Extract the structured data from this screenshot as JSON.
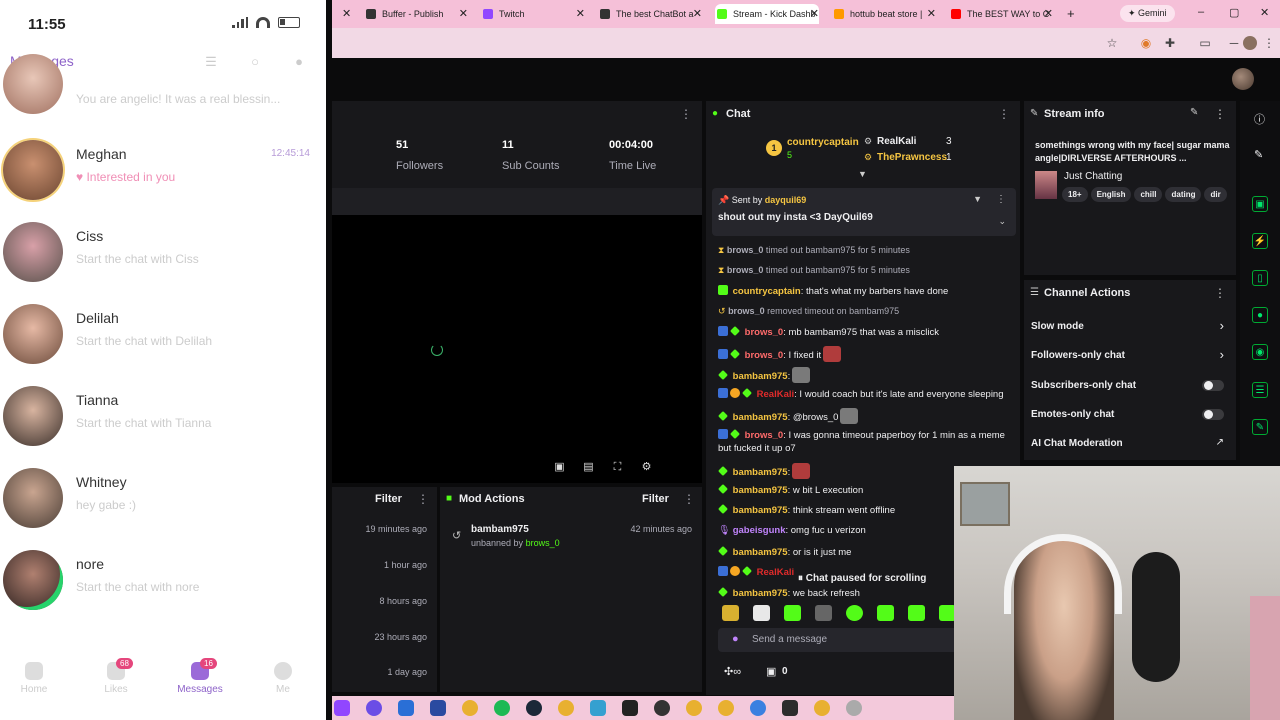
{
  "phone": {
    "time": "11:55",
    "title": "Messages",
    "contacts": [
      {
        "name": "",
        "sub": "You are angelic! It was a real blessin..."
      },
      {
        "name": "Meghan",
        "sub": "♥ Interested in you",
        "time": "12:45:14"
      },
      {
        "name": "Ciss",
        "sub": "Start the chat with Ciss"
      },
      {
        "name": "Delilah",
        "sub": "Start the chat with Delilah"
      },
      {
        "name": "Tianna",
        "sub": "Start the chat with Tianna"
      },
      {
        "name": "Whitney",
        "sub": "hey gabe :)"
      },
      {
        "name": "nore",
        "sub": "Start the chat with nore"
      }
    ],
    "nav": [
      {
        "label": "Home",
        "badge": ""
      },
      {
        "label": "Likes",
        "badge": "68"
      },
      {
        "label": "Messages",
        "badge": "16"
      },
      {
        "label": "Me",
        "badge": ""
      }
    ]
  },
  "browser": {
    "tabs": [
      {
        "label": "Buffer - Publish",
        "color": "#333333"
      },
      {
        "label": "Twitch",
        "color": "#9146ff"
      },
      {
        "label": "The best ChatBot a",
        "color": "#333333"
      },
      {
        "label": "Stream - Kick Dashb",
        "color": "#53fc18"
      },
      {
        "label": "hottub beat store |",
        "color": "#ff9900"
      },
      {
        "label": "The BEST WAY to C",
        "color": "#ff0000"
      }
    ],
    "gemini": "Gemini"
  },
  "stats": [
    {
      "value": "51",
      "label": "Followers"
    },
    {
      "value": "11",
      "label": "Sub Counts"
    },
    {
      "value": "00:04:00",
      "label": "Time Live"
    }
  ],
  "activity": {
    "filter": "Filter",
    "times": [
      "19 minutes ago",
      "1 hour ago",
      "8 hours ago",
      "23 hours ago",
      "1 day ago"
    ]
  },
  "mod_actions": {
    "title": "Mod Actions",
    "filter": "Filter",
    "entry_user": "bambam975",
    "entry_text": "unbanned by",
    "entry_by": "brows_0",
    "entry_time": "42 minutes ago"
  },
  "chat": {
    "title": "Chat",
    "top": [
      {
        "name": "countrycaptain",
        "count": "5"
      },
      {
        "name": "RealKali",
        "count": "3"
      },
      {
        "name": "ThePrawncess",
        "count": "1"
      }
    ],
    "pinned_by_label": "Sent by",
    "pinned_user": "dayquil69",
    "pinned_msg": "shout out my insta <3 DayQuil69",
    "paused": "Chat paused for scrolling",
    "send_placeholder": "Send a message",
    "footer_count": "0",
    "messages": [
      {
        "user": "brows_0",
        "text": " timed out bambam975 for 5 minutes",
        "system": true
      },
      {
        "user": "brows_0",
        "text": " timed out bambam975 for 5 minutes",
        "system": true
      },
      {
        "user": "countrycaptain",
        "text": ": that's what my barbers have done"
      },
      {
        "user": "brows_0",
        "text": " removed timeout on bambam975",
        "system": true
      },
      {
        "user": "brows_0",
        "text": ": mb bambam975 that was a misclick"
      },
      {
        "user": "brows_0",
        "text": ": I fixed it"
      },
      {
        "user": "bambam975",
        "text": ":"
      },
      {
        "user": "RealKali",
        "text": ": I would coach but it's late and everyone sleeping"
      },
      {
        "user": "bambam975",
        "text": ": @brows_0"
      },
      {
        "user": "brows_0",
        "text": ": I was gonna timeout paperboy for 1 min as a meme"
      },
      {
        "user": "",
        "text": "but fucked it up o7"
      },
      {
        "user": "bambam975",
        "text": ":"
      },
      {
        "user": "bambam975",
        "text": ": w bit L execution"
      },
      {
        "user": "bambam975",
        "text": ": think stream went offline"
      },
      {
        "user": "gabeisgunk",
        "text": ": omg fuc u verizon"
      },
      {
        "user": "bambam975",
        "text": ": or is it just me"
      },
      {
        "user": "RealKali",
        "text": ""
      },
      {
        "user": "bambam975",
        "text": ": we back refresh"
      }
    ]
  },
  "stream_info": {
    "title": "Stream info",
    "stream_title": "somethings wrong with my face| sugar mama angle|DIRLVERSE AFTERHOURS ...",
    "category": "Just Chatting",
    "tags": [
      "18+",
      "English",
      "chill",
      "dating",
      "dir"
    ]
  },
  "channel_actions": {
    "title": "Channel Actions",
    "items": [
      "Slow mode",
      "Followers-only chat",
      "Subscribers-only chat",
      "Emotes-only chat",
      "AI Chat Moderation"
    ]
  },
  "colors": {
    "accent": "#53fc18",
    "brows": "#ff6b6b",
    "bambam": "#f5c542",
    "country": "#f5c542",
    "kali": "#e02b2b",
    "gabe": "#c084fc",
    "prawn": "#f5c542"
  }
}
